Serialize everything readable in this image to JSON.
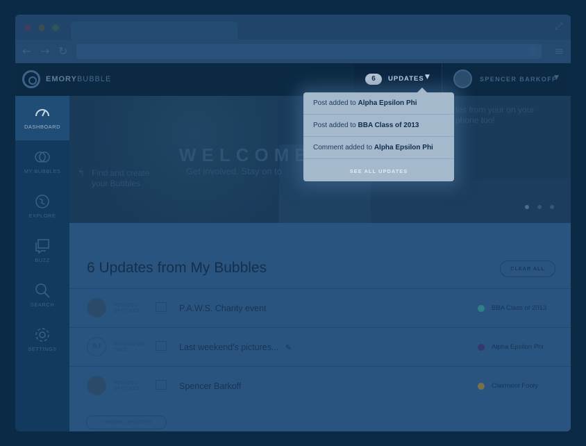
{
  "app": {
    "logo_bold": "EMORY",
    "logo_light": "BUBBLE",
    "user_name": "SPENCER BARKOFF"
  },
  "updates_menu": {
    "count": "6",
    "label": "UPDATES",
    "items": [
      {
        "prefix": "Post added to ",
        "target": "Alpha Epsilon Phi"
      },
      {
        "prefix": "Post added to ",
        "target": "BBA Class of 2013"
      },
      {
        "prefix": "Comment added to ",
        "target": "Alpha Epsilon Phi"
      }
    ],
    "see_all": "SEE ALL UPDATES"
  },
  "sidebar": {
    "items": [
      {
        "label": "DASHBOARD",
        "icon": "gauge-icon",
        "active": true
      },
      {
        "label": "MY BUBBLES",
        "icon": "bubbles-icon",
        "active": false
      },
      {
        "label": "EXPLORE",
        "icon": "globe-icon",
        "active": false
      },
      {
        "label": "BUZZ",
        "icon": "chat-icon",
        "active": false
      },
      {
        "label": "SEARCH",
        "icon": "search-icon",
        "active": false
      },
      {
        "label": "SETTINGS",
        "icon": "gear-icon",
        "active": false
      }
    ]
  },
  "hero": {
    "welcome": "WELCOME",
    "welcome_tail": "E",
    "subtitle": "Get involved. Stay on to",
    "left_text": "Find and create your Bubbles",
    "right_text": "tes from your on your phone too!"
  },
  "main": {
    "title": "6 Updates from My Bubbles",
    "clear_all": "CLEAR ALL",
    "more_updates": "+ MORE UPDATES",
    "rows": [
      {
        "meta": "POSTED 3 DAYS AGO",
        "title": "P.A.W.S. Charity event",
        "bubble": "BBA Class of 2013",
        "dot_color": "#2f7f86",
        "avatar": "photo"
      },
      {
        "meta": "REPLIED ON TUES",
        "title": "Last weekend's pictures...",
        "bubble": "Alpha Epsilon Phi",
        "dot_color": "#35386a",
        "avatar": "A.I"
      },
      {
        "meta": "POSTED 3 DAYS AGO",
        "title": "Spencer Barkoff",
        "bubble": "Clairmont Footy",
        "dot_color": "#7a7048",
        "avatar": "photo"
      }
    ]
  }
}
